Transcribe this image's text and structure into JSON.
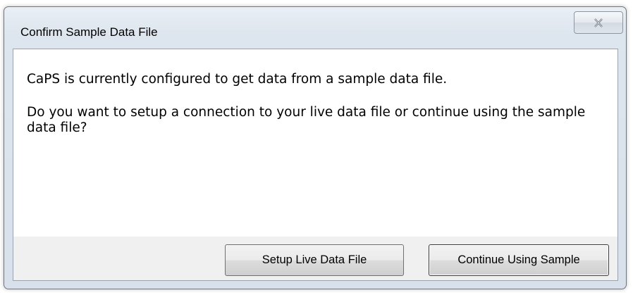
{
  "dialog": {
    "title": "Confirm Sample Data File",
    "close_icon": "close-icon",
    "message_line1": "CaPS is currently configured to get data from a sample data file.",
    "message_line2": "Do you want to setup a connection to your live data file or continue using the sample data file?",
    "buttons": {
      "setup_label": "Setup Live Data File",
      "continue_label": "Continue Using Sample"
    }
  },
  "colors": {
    "frame_border": "#6f7579",
    "frame_fill": "#dde5ee",
    "client_background": "#ffffff",
    "button_bar_background": "#f0f0f0"
  }
}
